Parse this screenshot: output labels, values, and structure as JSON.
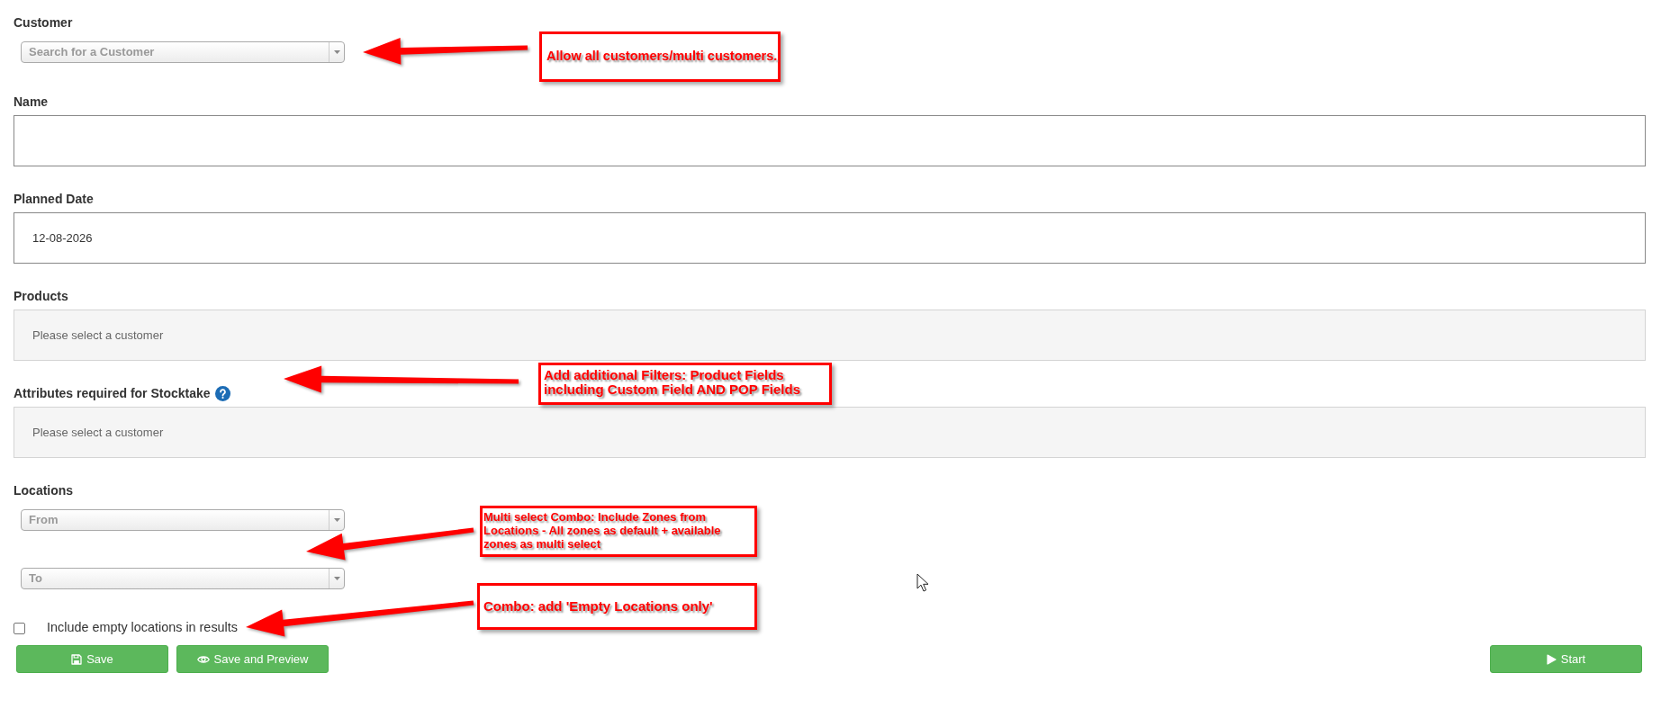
{
  "fields": [
    {
      "kind": "select",
      "label": "Customer",
      "placeholder": "Search for a Customer"
    },
    {
      "kind": "input",
      "label": "Name"
    },
    {
      "kind": "input",
      "label": "Planned Date",
      "value": "12-08-2026"
    },
    {
      "kind": "panel",
      "label": "Products",
      "message": "Please select a customer"
    },
    {
      "kind": "panel",
      "label": "Attributes required for Stocktake",
      "help": true,
      "message": "Please select a customer"
    },
    {
      "kind": "range",
      "label": "Locations",
      "from": {
        "placeholder": "From"
      },
      "to": {
        "placeholder": "To"
      }
    },
    {
      "kind": "checkbox",
      "label": "Include empty locations in results",
      "checked": false
    }
  ],
  "buttons": [
    {
      "kind": "save",
      "label": "Save"
    },
    {
      "kind": "preview",
      "label": "Save and Preview"
    },
    {
      "kind": "start",
      "label": "Start"
    }
  ],
  "annotations": [
    {
      "text": "Allow all customers/multi customers."
    },
    {
      "text": "Add additional Filters: Product Fields including Custom Field AND POP Fields"
    },
    {
      "text": "Multi select Combo: Include Zones from Locations - All zones as default + available zones as multi select"
    },
    {
      "text": "Combo: add 'Empty Locations only'"
    }
  ]
}
